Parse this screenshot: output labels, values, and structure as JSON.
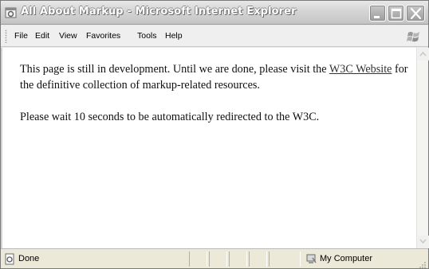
{
  "window": {
    "title": "All About Markup - Microsoft Internet Explorer",
    "controls": {
      "minimize_icon": "minimize-icon",
      "maximize_icon": "maximize-icon",
      "close_icon": "close-icon"
    }
  },
  "menu": {
    "items": [
      "File",
      "Edit",
      "View",
      "Favorites",
      "Tools",
      "Help"
    ]
  },
  "content": {
    "paragraph1_before_link": "This page is still in development. Until we are done, please visit the ",
    "link_text": "W3C Website",
    "paragraph1_after_link": " for the definitive collection of markup-related resources.",
    "paragraph2": "Please wait 10 seconds to be automatically redirected to the W3C."
  },
  "status": {
    "text": "Done",
    "zone": "My Computer"
  },
  "colors": {
    "title_text": "#ffffff",
    "titlebar": "#d0d0d0",
    "content_bg": "#ffffff",
    "chrome_bg": "#ece9d8"
  }
}
